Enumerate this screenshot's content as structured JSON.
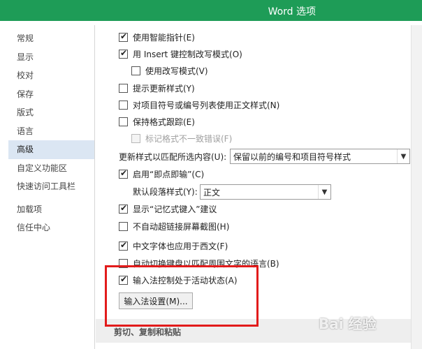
{
  "window": {
    "title": "Word 选项"
  },
  "sidebar": {
    "items": [
      {
        "label": "常规"
      },
      {
        "label": "显示"
      },
      {
        "label": "校对"
      },
      {
        "label": "保存"
      },
      {
        "label": "版式"
      },
      {
        "label": "语言"
      },
      {
        "label": "高级",
        "active": true
      },
      {
        "label": "自定义功能区"
      },
      {
        "label": "快速访问工具栏"
      },
      {
        "label": "加载项"
      },
      {
        "label": "信任中心"
      }
    ]
  },
  "options": {
    "smart_pointer": {
      "label": "使用智能指针(E)",
      "checked": true
    },
    "insert_key": {
      "label": "用 Insert 键控制改写模式(O)",
      "checked": true
    },
    "overtype": {
      "label": "使用改写模式(V)",
      "checked": false
    },
    "prompt_update_style": {
      "label": "提示更新样式(Y)",
      "checked": false
    },
    "normal_style_lists": {
      "label": "对项目符号或编号列表使用正文样式(N)",
      "checked": false
    },
    "keep_format": {
      "label": "保持格式跟踪(E)",
      "checked": false
    },
    "mark_inconsistencies": {
      "label": "标记格式不一致错误(F)",
      "checked": false,
      "disabled": true
    },
    "update_style_match_label": "更新样式以匹配所选内容(U):",
    "update_style_match_value": "保留以前的编号和项目符号样式",
    "click_and_type": {
      "label": "启用“即点即输”(C)",
      "checked": true
    },
    "default_para_label": "默认段落样式(Y):",
    "default_para_value": "正文",
    "autocomplete": {
      "label": "显示“记忆式键入”建议",
      "checked": true
    },
    "no_hyperlink_screenshot": {
      "label": "不自动超链接屏幕截图(H)",
      "checked": false
    },
    "chinese_font_western": {
      "label": "中文字体也应用于西文(F)",
      "checked": true
    },
    "auto_switch_keyboard": {
      "label": "自动切换键盘以匹配周围文字的语言(B)",
      "checked": false
    },
    "ime_control": {
      "label": "输入法控制处于活动状态(A)",
      "checked": true
    },
    "ime_settings_button": "输入法设置(M)..."
  },
  "section_cut_copy_paste": "剪切、复制和粘贴",
  "watermark": "Bai 经验",
  "colors": {
    "titlebar": "#1e9c57",
    "highlight": "#e21b1b",
    "nav_active": "#dbe6f3"
  }
}
